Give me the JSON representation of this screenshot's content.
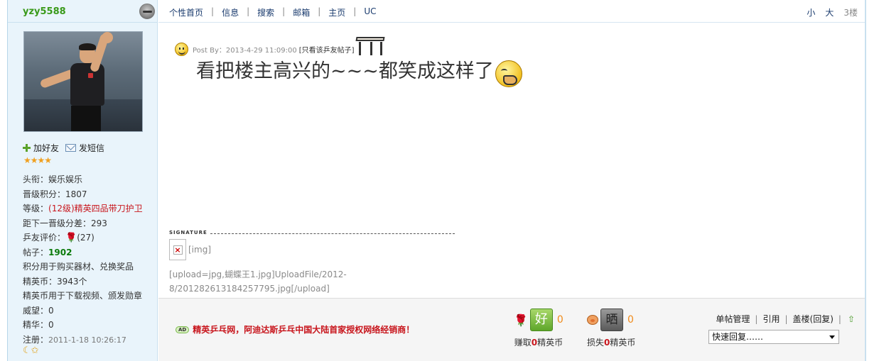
{
  "sidebar": {
    "username": "yzy5588",
    "actions": {
      "add_friend": "加好友",
      "send_message": "发短信"
    },
    "stars": "★★★★",
    "info": {
      "title_label": "头衔：",
      "title_value": "娱乐娱乐",
      "points_label": "晋级积分：",
      "points_value": "1807",
      "level_label": "等级：",
      "level_value": "(12级)精英四品带刀护卫",
      "next_label": "距下一晋级分差：",
      "next_value": "293",
      "rating_label": "乒友评价：",
      "rating_value": "(27)",
      "posts_label": "帖子：",
      "posts_value": "1902",
      "points_note": "积分用于购买器材、兑换奖品",
      "coins_label": "精英币：",
      "coins_value": "3943个",
      "coins_note": "精英币用于下载视频、颁发勋章",
      "prestige_label": "威望：",
      "prestige_value": "0",
      "essence_label": "精华：",
      "essence_value": "0",
      "register_label": "注册：",
      "register_value": "2011-1-18 10:26:17"
    },
    "bottom_icons": "☾✩"
  },
  "nav": {
    "links": [
      "个性首页",
      "信息",
      "搜索",
      "邮箱",
      "主页",
      "UC"
    ],
    "font_small": "小",
    "font_large": "大",
    "floor": "3楼"
  },
  "post": {
    "meta": "Post By：2013-4-29 11:09:00",
    "only_author": "[只看该乒友帖子]",
    "body": "看把楼主高兴的~~~都笑成这样了"
  },
  "signature": {
    "label": "SIGNATURE",
    "img_alt": "[img]",
    "upload_line1": "[upload=jpg,蝴蝶王1.jpg]UploadFile/2012-",
    "upload_line2": "8/201282613184257795.jpg[/upload]"
  },
  "footer": {
    "ad_badge": "AD",
    "ad_text": "精英乒乓网，阿迪达斯乒乓中国大陆首家授权网络经销商！",
    "good_badge": "好",
    "good_count": "0",
    "good_label_pre": "赚取",
    "good_label_num": "0",
    "good_label_post": "精英币",
    "bad_badge": "晒",
    "bad_count": "0",
    "bad_label_pre": "损失",
    "bad_label_num": "0",
    "bad_label_post": "精英币",
    "actions": [
      "单帖管理",
      "引用",
      "盖楼(回复)"
    ],
    "quick_reply": "快速回复……"
  }
}
